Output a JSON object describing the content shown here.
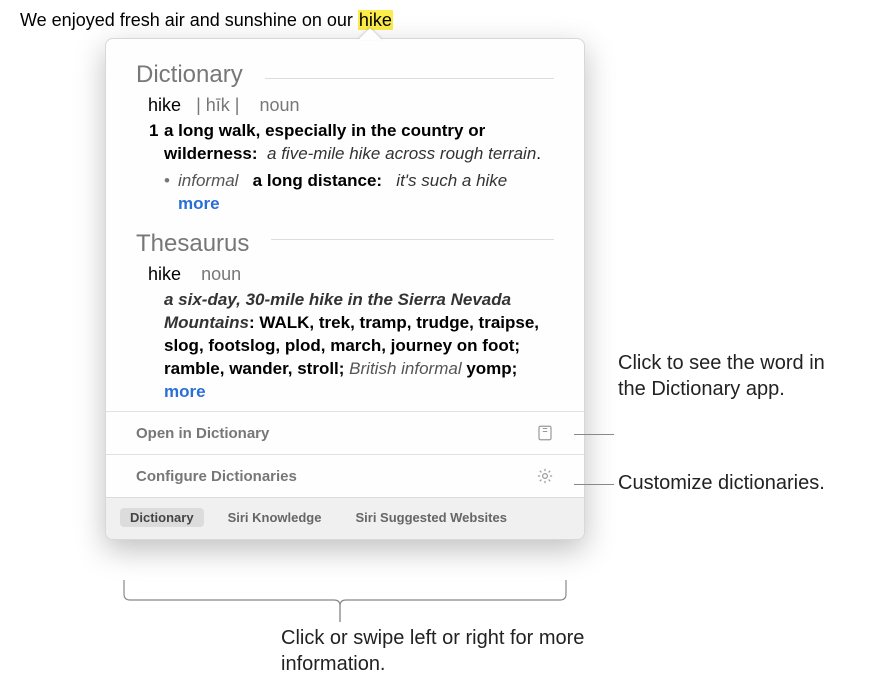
{
  "source_sentence": {
    "before": "We enjoyed fresh air and sunshine on our ",
    "highlighted": "hike"
  },
  "dictionary": {
    "section_title": "Dictionary",
    "headword": "hike",
    "pronunciation": "| hīk |",
    "pos": "noun",
    "def_number": "1",
    "definition": "a long walk, especially in the country or wilderness:",
    "example": "a five-mile hike across rough terrain",
    "sub_tag": "informal",
    "sub_def": "a long distance:",
    "sub_example": "it's such a hike",
    "more": "more"
  },
  "thesaurus": {
    "section_title": "Thesaurus",
    "headword": "hike",
    "pos": "noun",
    "example": "a six-day, 30-mile hike in the Sierra Nevada Mountains",
    "syn_first": "WALK,",
    "synonyms": " trek, tramp, trudge, traipse, slog, footslog, plod, march, journey on foot; ramble, wander, stroll; ",
    "brit_tag": "British informal",
    "brit_syns": " yomp; ",
    "more": "more"
  },
  "actions": {
    "open": "Open in Dictionary",
    "configure": "Configure Dictionaries"
  },
  "tabs": {
    "dictionary": "Dictionary",
    "siri_knowledge": "Siri Knowledge",
    "siri_websites": "Siri Suggested Websites"
  },
  "callouts": {
    "open": "Click to see the word in the Dictionary app.",
    "configure": "Customize dictionaries.",
    "tabs": "Click or swipe left or right for more information."
  }
}
